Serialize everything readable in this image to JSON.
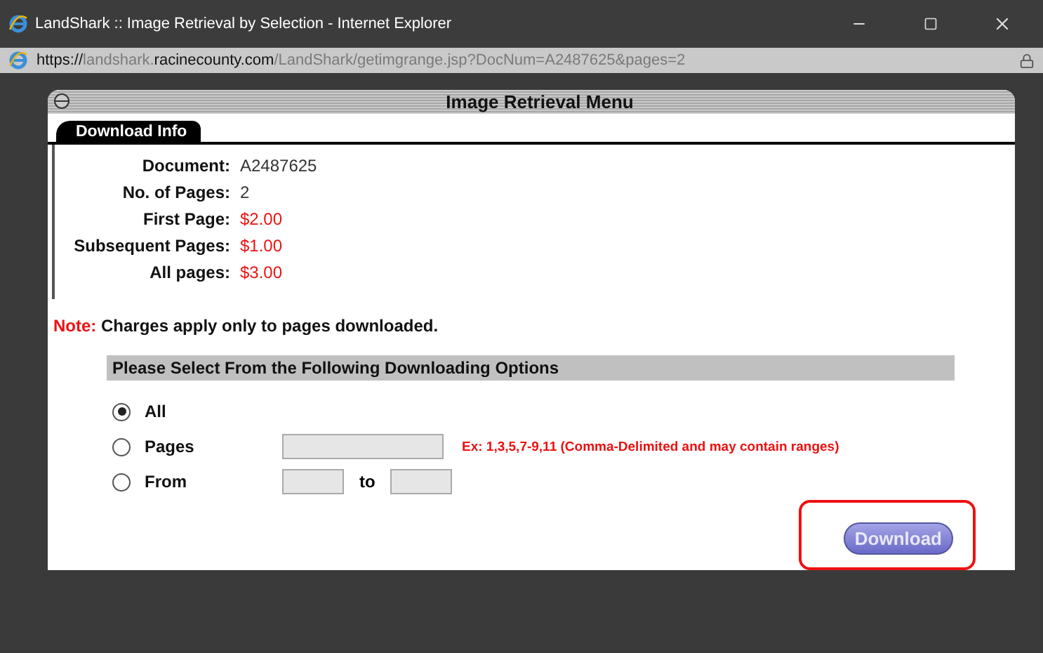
{
  "window": {
    "title": "LandShark :: Image Retrieval by Selection - Internet Explorer"
  },
  "address_bar": {
    "url": [
      {
        "text": "https://",
        "dim": false
      },
      {
        "text": "landshark.",
        "dim": true
      },
      {
        "text": "racinecounty.com",
        "dim": false
      },
      {
        "text": "/LandShark/getimgrange.jsp?DocNum=A2487625&pages=2",
        "dim": true
      }
    ]
  },
  "panel": {
    "title": "Image Retrieval Menu",
    "tab": "Download Info",
    "info": [
      {
        "label": "Document:",
        "value": "A2487625",
        "kind": "plain"
      },
      {
        "label": "No. of Pages:",
        "value": "2",
        "kind": "plain"
      },
      {
        "label": "First Page:",
        "value": "$2.00",
        "kind": "price"
      },
      {
        "label": "Subsequent Pages:",
        "value": "$1.00",
        "kind": "price"
      },
      {
        "label": "All pages:",
        "value": "$3.00",
        "kind": "price"
      }
    ],
    "note": {
      "label": "Note:",
      "text": "Charges apply only to pages downloaded."
    },
    "options_heading": "Please Select From the Following Downloading Options",
    "options": [
      {
        "label": "All",
        "selected": true,
        "kind": "plain"
      },
      {
        "label": "Pages",
        "selected": false,
        "kind": "pages",
        "hint": "Ex: 1,3,5,7-9,11 (Comma-Delimited and may contain ranges)"
      },
      {
        "label": "From",
        "selected": false,
        "kind": "range",
        "separator": "to"
      }
    ],
    "download_button": {
      "label": "Download",
      "highlighted": true
    }
  }
}
